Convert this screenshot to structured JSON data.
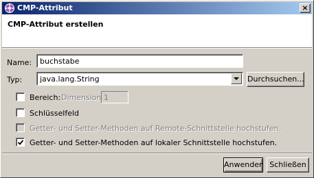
{
  "window": {
    "title": "CMP-Attribut",
    "close_label": "×"
  },
  "header": {
    "title": "CMP-Attribut erstellen"
  },
  "form": {
    "name_label": "Name:",
    "name_value": "buchstabe",
    "type_label": "Typ:",
    "type_value": "java.lang.String",
    "browse_label": "Durchsuchen...",
    "range_label": "Bereich:",
    "range_checked": false,
    "dimension_label": "Dimension:",
    "dimension_value": "1",
    "key_label": "Schlüsselfeld",
    "key_checked": false,
    "remote_label": "Getter- und Setter-Methoden auf Remote-Schnittstelle hochstufen.",
    "remote_checked": false,
    "local_label": "Getter- und Setter-Methoden auf lokaler Schnittstelle hochstufen.",
    "local_checked": true
  },
  "footer": {
    "apply_label": "Anwenden",
    "close_label": "Schließen"
  },
  "colors": {
    "titlebar_start": "#0a246a",
    "titlebar_end": "#a6caf0",
    "dialog_bg": "#d4d0c8"
  }
}
